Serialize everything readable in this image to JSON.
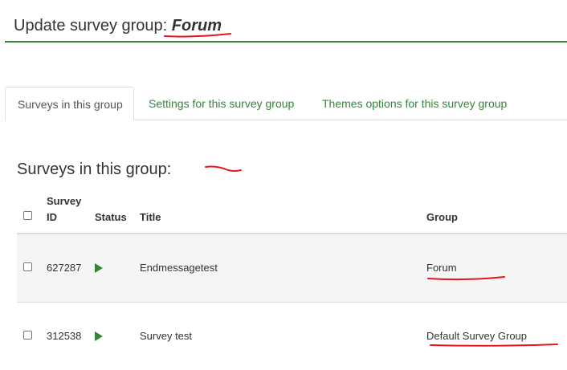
{
  "header": {
    "title_prefix": "Update survey group:",
    "group_name": "Forum"
  },
  "tabs": [
    {
      "label": "Surveys in this group",
      "active": true
    },
    {
      "label": "Settings for this survey group",
      "active": false
    },
    {
      "label": "Themes options for this survey group",
      "active": false
    }
  ],
  "section": {
    "title": "Surveys in this group:"
  },
  "table": {
    "columns": {
      "survey_id": "Survey\nID",
      "status": "Status",
      "title": "Title",
      "group": "Group"
    },
    "rows": [
      {
        "id": "627287",
        "status": "active-icon",
        "title": "Endmessagetest",
        "group": "Forum"
      },
      {
        "id": "312538",
        "status": "active-icon",
        "title": "Survey test",
        "group": "Default Survey Group"
      }
    ]
  },
  "colors": {
    "accent": "#328637",
    "annotation": "#e8141e"
  }
}
